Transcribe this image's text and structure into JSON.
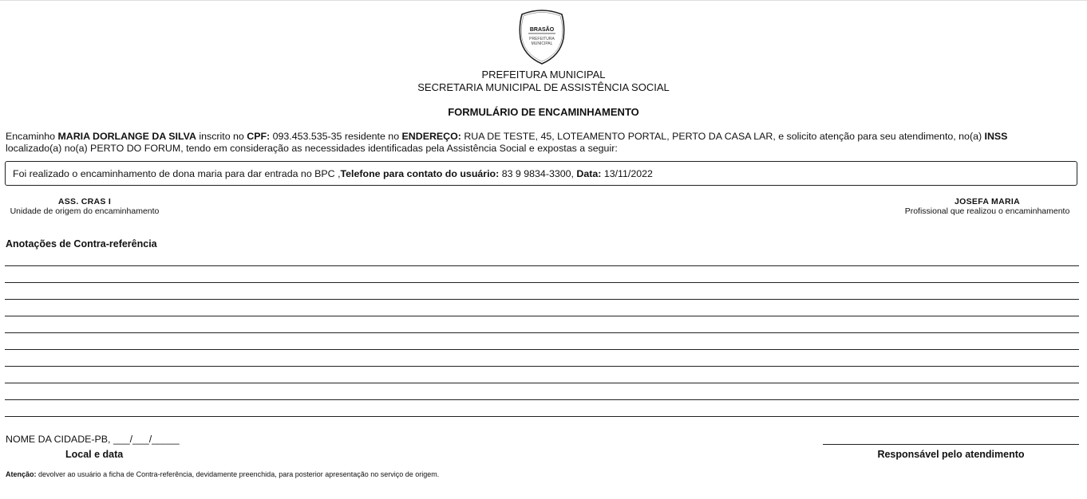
{
  "crest": {
    "title": "BRASÃO",
    "line1": "PREFEITURA",
    "line2": "MUNICIPAL"
  },
  "header": {
    "line1": "PREFEITURA MUNICIPAL",
    "line2": "SECRETARIA MUNICIPAL DE ASSISTÊNCIA SOCIAL",
    "form_title": "FORMULÁRIO DE ENCAMINHAMENTO"
  },
  "referral": {
    "t1": "Encaminho ",
    "name": "MARIA DORLANGE DA SILVA",
    "t2": " inscrito no ",
    "cpf_label": "CPF:",
    "cpf": " 093.453.535-35",
    "t3": " residente no ",
    "address_label": "ENDEREÇO:",
    "address": " RUA DE TESTE, 45, LOTEAMENTO PORTAL, PERTO DA CASA LAR",
    "t4": ", e solicito atenção para seu atendimento, no(a) ",
    "institution": "INSS",
    "t5": "localizado(a) no(a) PERTO DO FORUM, tendo em consideração as necessidades identificadas pela Assistência Social e expostas a seguir:"
  },
  "notes_box": {
    "text": "Foi realizado o encaminhamento de dona maria para dar entrada no BPC ,",
    "phone_label": "Telefone para contato do usuário:",
    "phone": " 83 9 9834-3300, ",
    "date_label": "Data:",
    "date": " 13/11/2022"
  },
  "signatures": {
    "origin_name": "ASS. CRAS I",
    "origin_caption": "Unidade de origem do encaminhamento",
    "professional_name": "JOSEFA MARIA",
    "professional_caption": "Profissional que realizou o encaminhamento"
  },
  "counter_reference": {
    "heading": "Anotações de Contra-referência"
  },
  "footer": {
    "city_date": "NOME DA CIDADE-PB, ___/___/_____",
    "local_data_label": "Local e data",
    "responsible_label": "Responsável pelo atendimento",
    "attention_label": "Atenção:",
    "attention_text": " devolver ao usuário a ficha de Contra-referência, devidamente preenchida, para posterior apresentação no serviço de origem."
  }
}
